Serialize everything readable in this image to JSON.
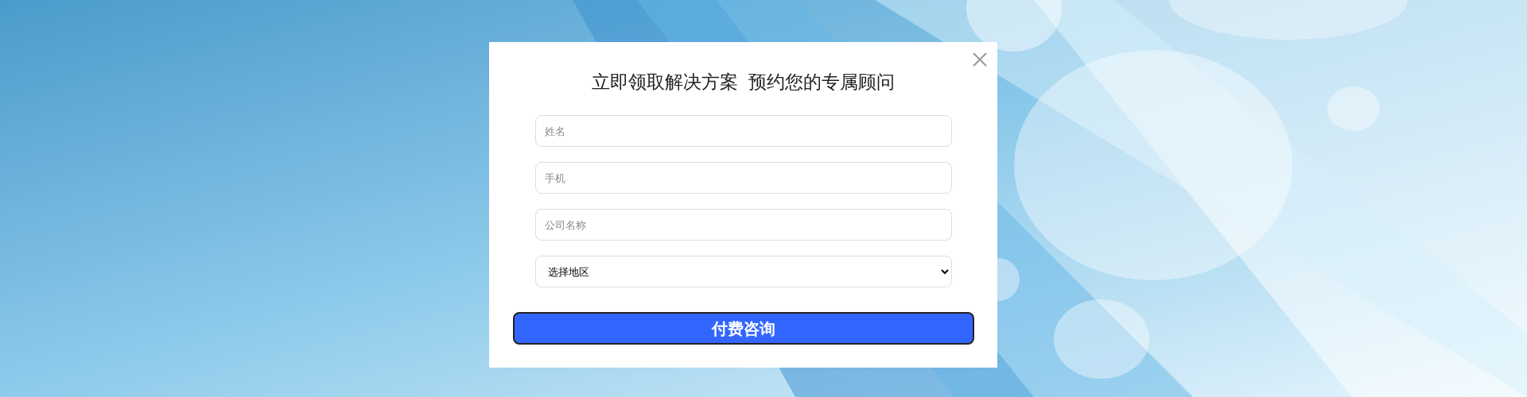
{
  "dialog": {
    "title": "立即领取解决方案  预约您的专属顾问",
    "fields": [
      {
        "kind": "input",
        "placeholder": "姓名"
      },
      {
        "kind": "input",
        "placeholder": "手机"
      },
      {
        "kind": "input",
        "placeholder": "公司名称"
      },
      {
        "kind": "select",
        "value": "选择地区"
      }
    ],
    "submit": "付费咨询"
  }
}
